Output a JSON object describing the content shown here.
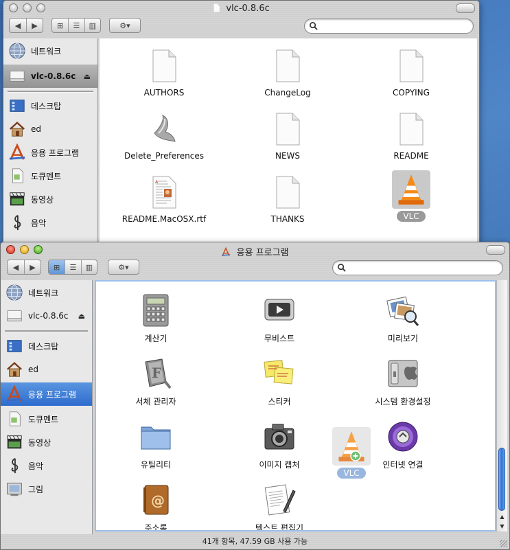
{
  "back_window": {
    "title": "vlc-0.8.6c",
    "sidebar": [
      {
        "label": "네트워크",
        "icon": "network-globe-icon"
      },
      {
        "label": "vlc-0.8.6c",
        "icon": "disk-image-icon",
        "eject": "⏏"
      },
      {
        "label": "데스크탑",
        "icon": "desktop-icon"
      },
      {
        "label": "ed",
        "icon": "home-icon"
      },
      {
        "label": "응용 프로그램",
        "icon": "applications-icon"
      },
      {
        "label": "도큐멘트",
        "icon": "documents-icon"
      },
      {
        "label": "동영상",
        "icon": "movies-icon"
      },
      {
        "label": "음악",
        "icon": "music-icon"
      }
    ],
    "files": [
      {
        "label": "AUTHORS",
        "icon": "document-icon"
      },
      {
        "label": "ChangeLog",
        "icon": "document-icon"
      },
      {
        "label": "COPYING",
        "icon": "document-icon"
      },
      {
        "label": "Delete_Preferences",
        "icon": "script-icon"
      },
      {
        "label": "NEWS",
        "icon": "document-icon"
      },
      {
        "label": "README",
        "icon": "document-icon"
      },
      {
        "label": "README.MacOSX.rtf",
        "icon": "rtf-document-icon"
      },
      {
        "label": "THANKS",
        "icon": "document-icon"
      },
      {
        "label": "VLC",
        "icon": "vlc-cone-icon"
      }
    ]
  },
  "front_window": {
    "title": "응용 프로그램",
    "sidebar": [
      {
        "label": "네트워크",
        "icon": "network-globe-icon"
      },
      {
        "label": "vlc-0.8.6c",
        "icon": "disk-image-icon",
        "eject": "⏏"
      },
      {
        "label": "데스크탑",
        "icon": "desktop-icon"
      },
      {
        "label": "ed",
        "icon": "home-icon"
      },
      {
        "label": "응용 프로그램",
        "icon": "applications-icon"
      },
      {
        "label": "도큐멘트",
        "icon": "documents-icon"
      },
      {
        "label": "동영상",
        "icon": "movies-icon"
      },
      {
        "label": "음악",
        "icon": "music-icon"
      },
      {
        "label": "그림",
        "icon": "pictures-icon"
      }
    ],
    "apps": [
      {
        "label": "계산기",
        "icon": "calculator-icon"
      },
      {
        "label": "무비스트",
        "icon": "movist-icon"
      },
      {
        "label": "미리보기",
        "icon": "preview-icon"
      },
      {
        "label": "서체 관리자",
        "icon": "font-book-icon"
      },
      {
        "label": "스티커",
        "icon": "stickies-icon"
      },
      {
        "label": "시스템 환경설정",
        "icon": "system-preferences-icon"
      },
      {
        "label": "유틸리티",
        "icon": "utilities-folder-icon"
      },
      {
        "label": "이미지 캡처",
        "icon": "image-capture-icon"
      },
      {
        "label": "VLC",
        "icon": "vlc-cone-icon"
      },
      {
        "label": "인터넷 연결",
        "icon": "internet-connect-icon"
      },
      {
        "label": "주소록",
        "icon": "address-book-icon"
      },
      {
        "label": "텍스트 편집기",
        "icon": "textedit-icon"
      }
    ],
    "status": "41개 항목, 47.59 GB 사용 가능"
  },
  "colors": {
    "selection_blue": "#2d6ccd",
    "vlc_orange": "#f07a12"
  }
}
